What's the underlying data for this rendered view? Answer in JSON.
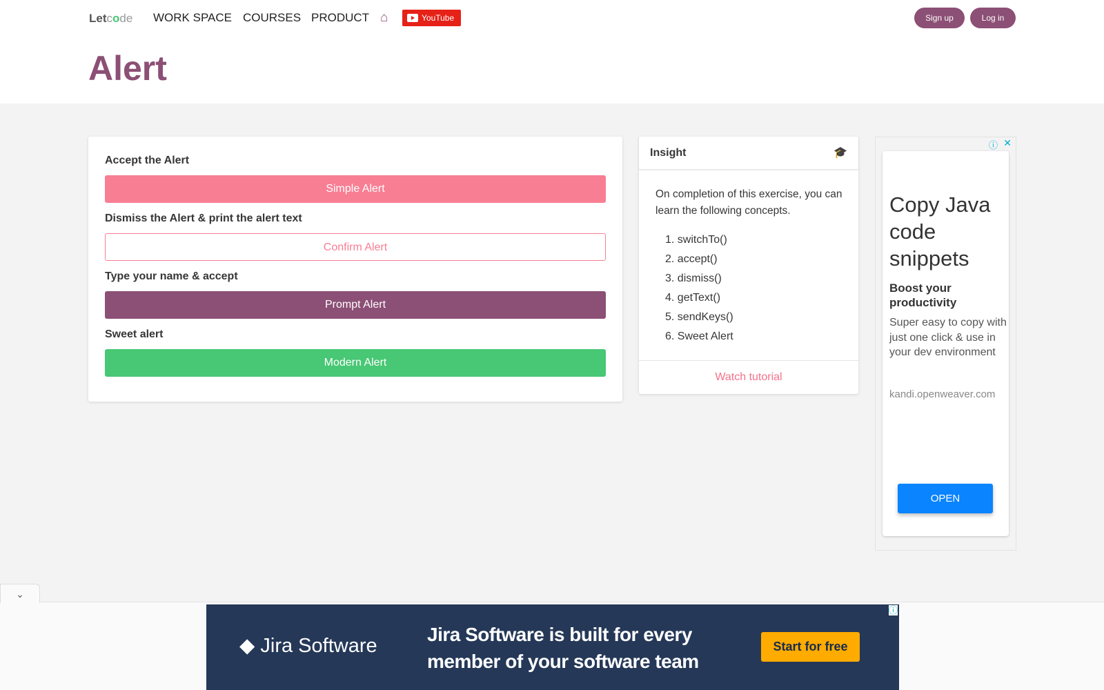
{
  "header": {
    "logo_pre": "Let",
    "logo_c": "c",
    "logo_o": "o",
    "logo_post": "de",
    "nav": [
      "WORK SPACE",
      "COURSES",
      "PRODUCT"
    ],
    "youtube": "YouTube",
    "signup": "Sign up",
    "login": "Log in"
  },
  "page_title": "Alert",
  "alerts": [
    {
      "label": "Accept the Alert",
      "button": "Simple Alert"
    },
    {
      "label": "Dismiss the Alert & print the alert text",
      "button": "Confirm Alert"
    },
    {
      "label": "Type your name & accept",
      "button": "Prompt Alert"
    },
    {
      "label": "Sweet alert",
      "button": "Modern Alert"
    }
  ],
  "insight": {
    "title": "Insight",
    "text": "On completion of this exercise, you can learn the following concepts.",
    "items": [
      "1. switchTo()",
      "2. accept()",
      "3. dismiss()",
      "4. getText()",
      "5. sendKeys()",
      "6. Sweet Alert"
    ],
    "footer": "Watch tutorial"
  },
  "side_ad": {
    "headline": "Copy Java code snippets",
    "sub": "Boost your productivity",
    "body": "Super easy to copy with just one click & use in your dev environment",
    "domain": "kandi.openweaver.com",
    "cta": "OPEN"
  },
  "bottom_ad": {
    "brand": "Jira Software",
    "headline": "Jira Software is built for every member of your software team",
    "cta": "Start for free"
  },
  "colors": {
    "brand": "#8c4f75",
    "pink": "#f87e93",
    "green": "#48c774",
    "ad_blue": "#0a84ff",
    "jira_bg": "#253858",
    "jira_cta": "#ffab00"
  }
}
